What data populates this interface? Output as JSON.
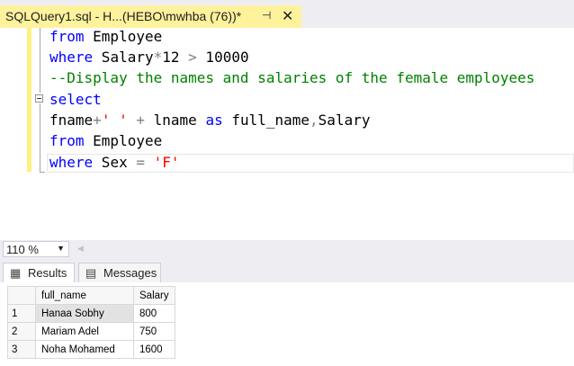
{
  "doc_tab": {
    "title": "SQLQuery1.sql - H...(HEBO\\mwhba (76))*",
    "pin_icon": "⊣",
    "close_icon": "✕"
  },
  "editor": {
    "lines": [
      {
        "parts": [
          {
            "t": "from",
            "c": "kw"
          },
          {
            "t": " Employee",
            "c": ""
          }
        ]
      },
      {
        "parts": [
          {
            "t": "where",
            "c": "kw"
          },
          {
            "t": " Salary",
            "c": ""
          },
          {
            "t": "*",
            "c": "op"
          },
          {
            "t": "12 ",
            "c": ""
          },
          {
            "t": ">",
            "c": "op"
          },
          {
            "t": " 10000",
            "c": ""
          }
        ]
      },
      {
        "parts": [
          {
            "t": "--Display the names and salaries of the female employees",
            "c": "cmt"
          }
        ]
      },
      {
        "parts": [
          {
            "t": "select",
            "c": "kw"
          }
        ]
      },
      {
        "parts": [
          {
            "t": "fname",
            "c": ""
          },
          {
            "t": "+",
            "c": "op"
          },
          {
            "t": "' '",
            "c": "str"
          },
          {
            "t": " ",
            "c": ""
          },
          {
            "t": "+",
            "c": "op"
          },
          {
            "t": " lname ",
            "c": ""
          },
          {
            "t": "as",
            "c": "kw"
          },
          {
            "t": " full_name",
            "c": ""
          },
          {
            "t": ",",
            "c": "op"
          },
          {
            "t": "Salary",
            "c": ""
          }
        ]
      },
      {
        "parts": [
          {
            "t": "from",
            "c": "kw"
          },
          {
            "t": " Employee",
            "c": ""
          }
        ]
      },
      {
        "parts": [
          {
            "t": "where",
            "c": "kw"
          },
          {
            "t": " Sex ",
            "c": ""
          },
          {
            "t": "=",
            "c": "op"
          },
          {
            "t": " ",
            "c": ""
          },
          {
            "t": "'F'",
            "c": "str"
          }
        ]
      }
    ]
  },
  "zoom": {
    "value": "110 %",
    "arrow": "▼"
  },
  "results_tabs": [
    {
      "label": "Results",
      "icon": "▦"
    },
    {
      "label": "Messages",
      "icon": "▤"
    }
  ],
  "grid": {
    "columns": [
      "full_name",
      "Salary"
    ],
    "rows": [
      {
        "num": "1",
        "full_name": "Hanaa Sobhy",
        "salary": "800"
      },
      {
        "num": "2",
        "full_name": "Mariam Adel",
        "salary": "750"
      },
      {
        "num": "3",
        "full_name": "Noha Mohamed",
        "salary": "1600"
      }
    ]
  },
  "colors": {
    "keyword": "#0000ff",
    "string": "#ff0000",
    "comment": "#008000",
    "operator": "#808080",
    "tab_active": "#fff29d"
  }
}
